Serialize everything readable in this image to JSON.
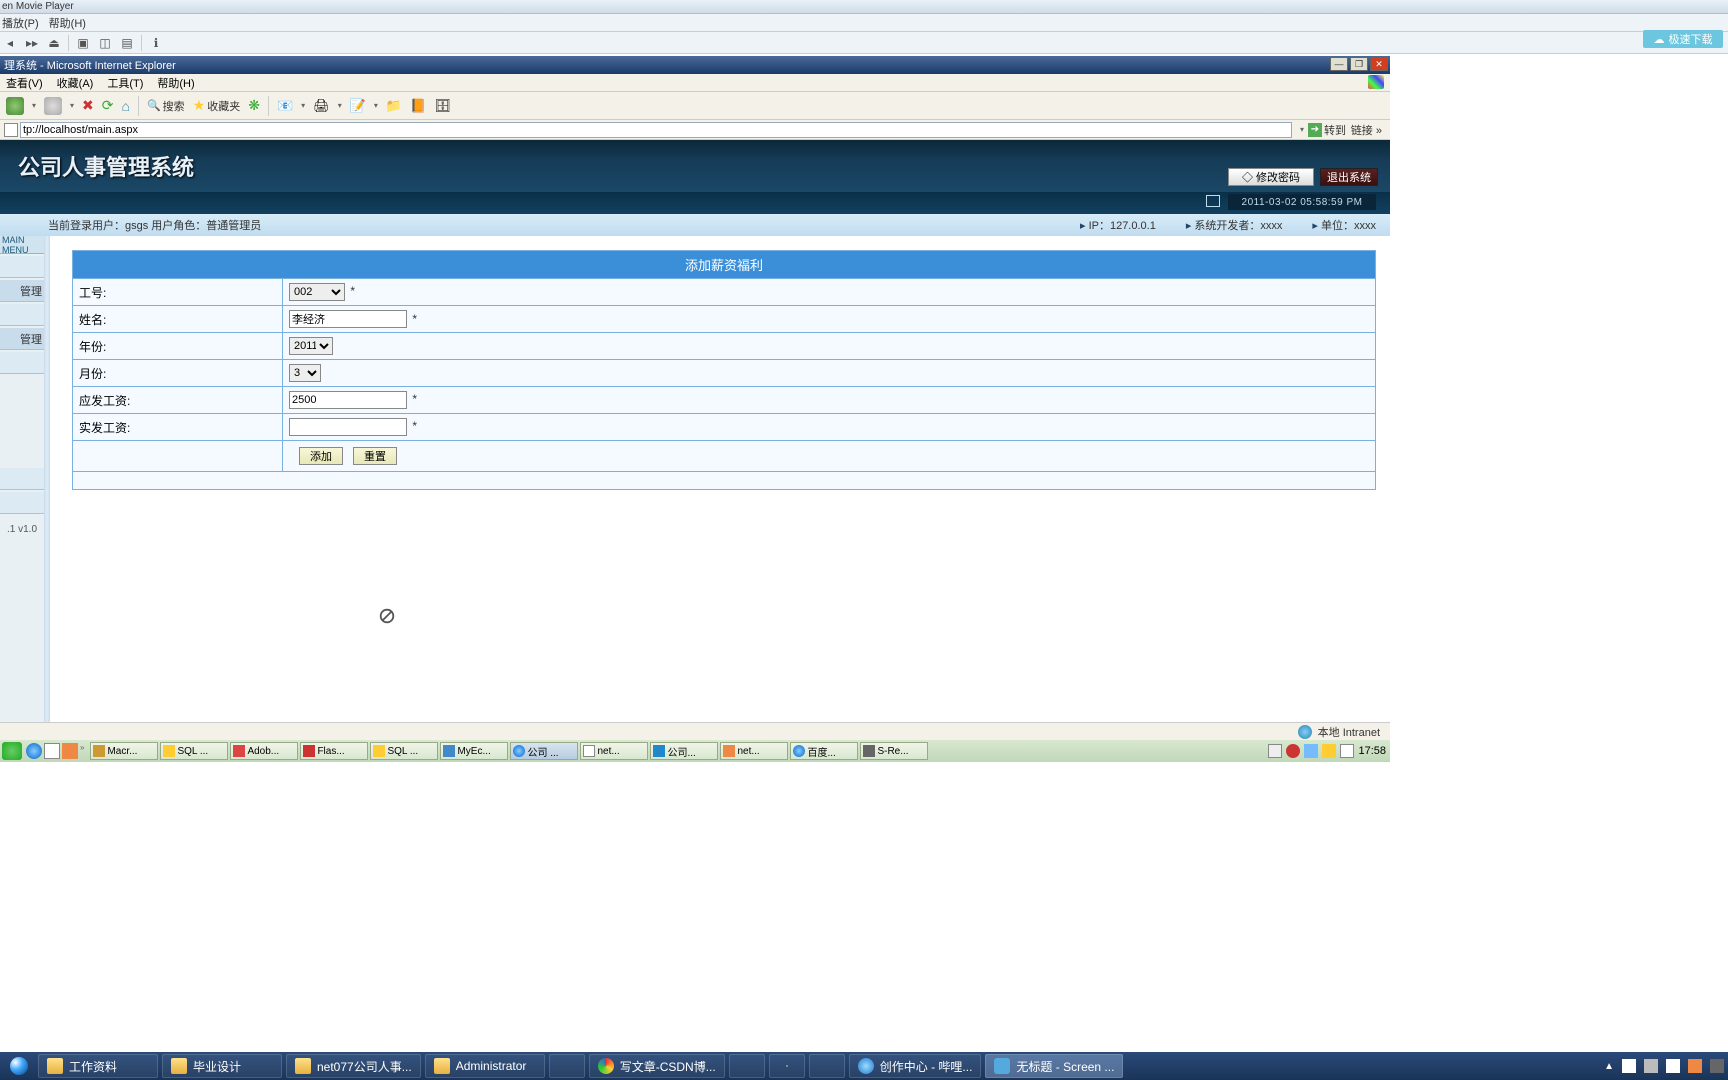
{
  "player": {
    "title": "en Movie Player",
    "menu": [
      "播放(P)",
      "帮助(H)"
    ],
    "cloud_label": "极速下载"
  },
  "ie": {
    "title": "理系统 - Microsoft Internet Explorer",
    "menu": [
      "查看(V)",
      "收藏(A)",
      "工具(T)",
      "帮助(H)"
    ],
    "toolbar": {
      "search": "搜索",
      "fav": "收藏夹"
    },
    "address": "tp://localhost/main.aspx",
    "go": "转到",
    "links": "链接",
    "status": "本地 Intranet"
  },
  "app": {
    "title": "公司人事管理系统",
    "btn_pwd": "◇ 修改密码",
    "btn_exit": "退出系统",
    "timestamp": "2011-03-02 05:58:59 PM",
    "main_menu": "MAIN MENU",
    "info_left": "当前登录用户：gsgs    用户角色：普通管理员",
    "info_ip": "IP：127.0.0.1",
    "info_dev": "系统开发者：xxxx",
    "info_unit": "单位：xxxx",
    "side_items": [
      "管理",
      "管理",
      "",
      "",
      ""
    ],
    "side_ver": ".1 v1.0"
  },
  "form": {
    "title": "添加薪资福利",
    "labels": {
      "emp_no": "工号:",
      "name": "姓名:",
      "year": "年份:",
      "month": "月份:",
      "gross": "应发工资:",
      "net": "实发工资:"
    },
    "values": {
      "emp_no": "002",
      "name": "李经济",
      "year": "2011",
      "month": "3",
      "gross": "2500",
      "net": ""
    },
    "btn_add": "添加",
    "btn_reset": "重置",
    "req": "*"
  },
  "xp": {
    "tasks": [
      "Macr...",
      "SQL ...",
      "Adob...",
      "Flas...",
      "SQL ...",
      "MyEc...",
      "公司 ...",
      "net...",
      "公司...",
      "net...",
      "百度...",
      "S-Re..."
    ],
    "clock": "17:58"
  },
  "win7": {
    "tasks": [
      "工作资料",
      "毕业设计",
      "net077公司人事...",
      "Administrator"
    ],
    "apps": [
      "写文章-CSDN博...",
      "创作中心 - 哔哩...",
      "无标题 - Screen ..."
    ]
  }
}
